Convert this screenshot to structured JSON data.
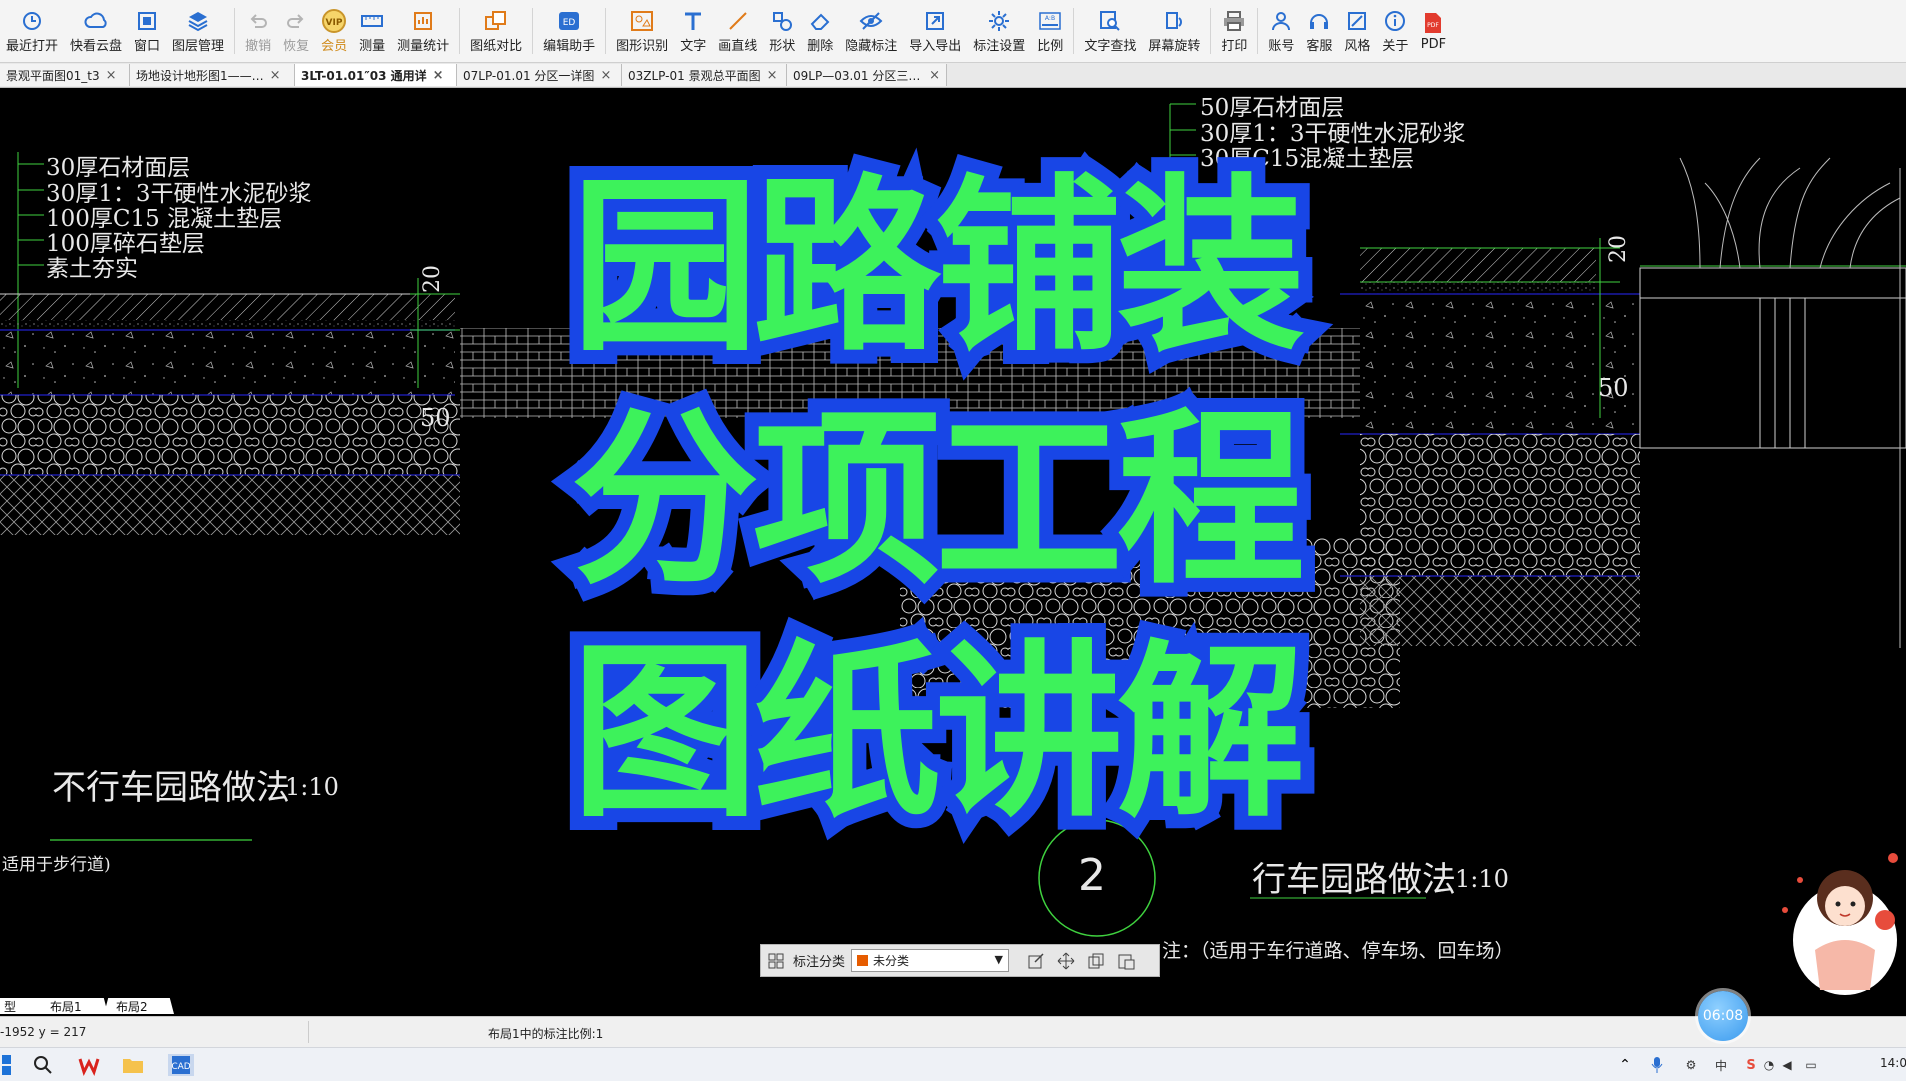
{
  "toolbar": {
    "items": [
      {
        "name": "recent-open",
        "label": "最近打开",
        "icon": "clock-icon"
      },
      {
        "name": "cloud",
        "label": "快看云盘",
        "icon": "cloud-icon"
      },
      {
        "name": "window",
        "label": "窗口",
        "icon": "window-icon"
      },
      {
        "name": "layers",
        "label": "图层管理",
        "icon": "layers-icon"
      },
      {
        "name": "undo",
        "label": "撤销",
        "icon": "undo-icon",
        "disabled": true
      },
      {
        "name": "redo",
        "label": "恢复",
        "icon": "redo-icon",
        "disabled": true
      },
      {
        "name": "vip",
        "label": "会员",
        "icon": "vip-icon",
        "vip": true
      },
      {
        "name": "measure",
        "label": "测量",
        "icon": "ruler-icon"
      },
      {
        "name": "measure-stats",
        "label": "测量统计",
        "icon": "stats-icon"
      },
      {
        "name": "compare",
        "label": "图纸对比",
        "icon": "compare-icon"
      },
      {
        "name": "edit-helper",
        "label": "编辑助手",
        "icon": "edit-helper-icon"
      },
      {
        "name": "shape-recog",
        "label": "图形识别",
        "icon": "shape-recognition-icon"
      },
      {
        "name": "text",
        "label": "文字",
        "icon": "text-icon"
      },
      {
        "name": "line",
        "label": "画直线",
        "icon": "line-icon"
      },
      {
        "name": "shape",
        "label": "形状",
        "icon": "shape-icon"
      },
      {
        "name": "delete",
        "label": "删除",
        "icon": "eraser-icon"
      },
      {
        "name": "hide-anno",
        "label": "隐藏标注",
        "icon": "eye-hide-icon"
      },
      {
        "name": "import-export",
        "label": "导入导出",
        "icon": "import-export-icon"
      },
      {
        "name": "anno-settings",
        "label": "标注设置",
        "icon": "settings-icon"
      },
      {
        "name": "scale",
        "label": "比例",
        "icon": "scale-icon"
      },
      {
        "name": "text-search",
        "label": "文字查找",
        "icon": "text-search-icon"
      },
      {
        "name": "rotate",
        "label": "屏幕旋转",
        "icon": "rotate-icon"
      },
      {
        "name": "print",
        "label": "打印",
        "icon": "printer-icon"
      },
      {
        "name": "account",
        "label": "账号",
        "icon": "user-icon"
      },
      {
        "name": "service",
        "label": "客服",
        "icon": "headset-icon"
      },
      {
        "name": "style",
        "label": "风格",
        "icon": "style-icon"
      },
      {
        "name": "about",
        "label": "关于",
        "icon": "info-icon"
      },
      {
        "name": "pdf",
        "label": "PDF",
        "icon": "pdf-icon"
      }
    ]
  },
  "tabs": [
    {
      "label": "景观平面图01_t3",
      "active": false
    },
    {
      "label": "场地设计地形图1——…",
      "active": false
    },
    {
      "label": "3LT-01.01″03 通用详",
      "active": true
    },
    {
      "label": "07LP-01.01 分区一详图",
      "active": false
    },
    {
      "label": "03ZLP-01 景观总平面图",
      "active": false
    },
    {
      "label": "09LP—03.01 分区三详图",
      "active": false
    }
  ],
  "drawing": {
    "left_layers": [
      "30厚石材面层",
      "30厚1：3干硬性水泥砂浆",
      "100厚C15 混凝土垫层",
      "100厚碎石垫层",
      "素土夯实"
    ],
    "right_layers": [
      "50厚石材面层",
      "30厚1：3干硬性水泥砂浆",
      "30厚C15混凝土垫层"
    ],
    "left_title": "不行车园路做法",
    "left_scale": "1:10",
    "left_note": "适用于步行道)",
    "right_title": "行车园路做法",
    "right_scale": "1:10",
    "right_note": "注：（适用于车行道路、停车场、回车场）",
    "circle_label": "2",
    "dims": {
      "d20": "20",
      "d50": "50"
    }
  },
  "overlay_title": [
    "园路铺装",
    "分项工程",
    "图纸讲解"
  ],
  "annotation_bar": {
    "label": "标注分类",
    "selected": "未分类",
    "swatch": "#e65c00"
  },
  "layout_tabs": [
    "型",
    "布局1",
    "布局2"
  ],
  "status": {
    "coords": "-1952 y = 217",
    "scale_text": "布局1中的标注比例:1"
  },
  "timer": "06:08",
  "clock": "14:0",
  "colors": {
    "title_fill": "#3df25b",
    "title_stroke": "#1846e6",
    "cad_green": "#3fd23f",
    "cad_blue": "#1a1aa8"
  }
}
